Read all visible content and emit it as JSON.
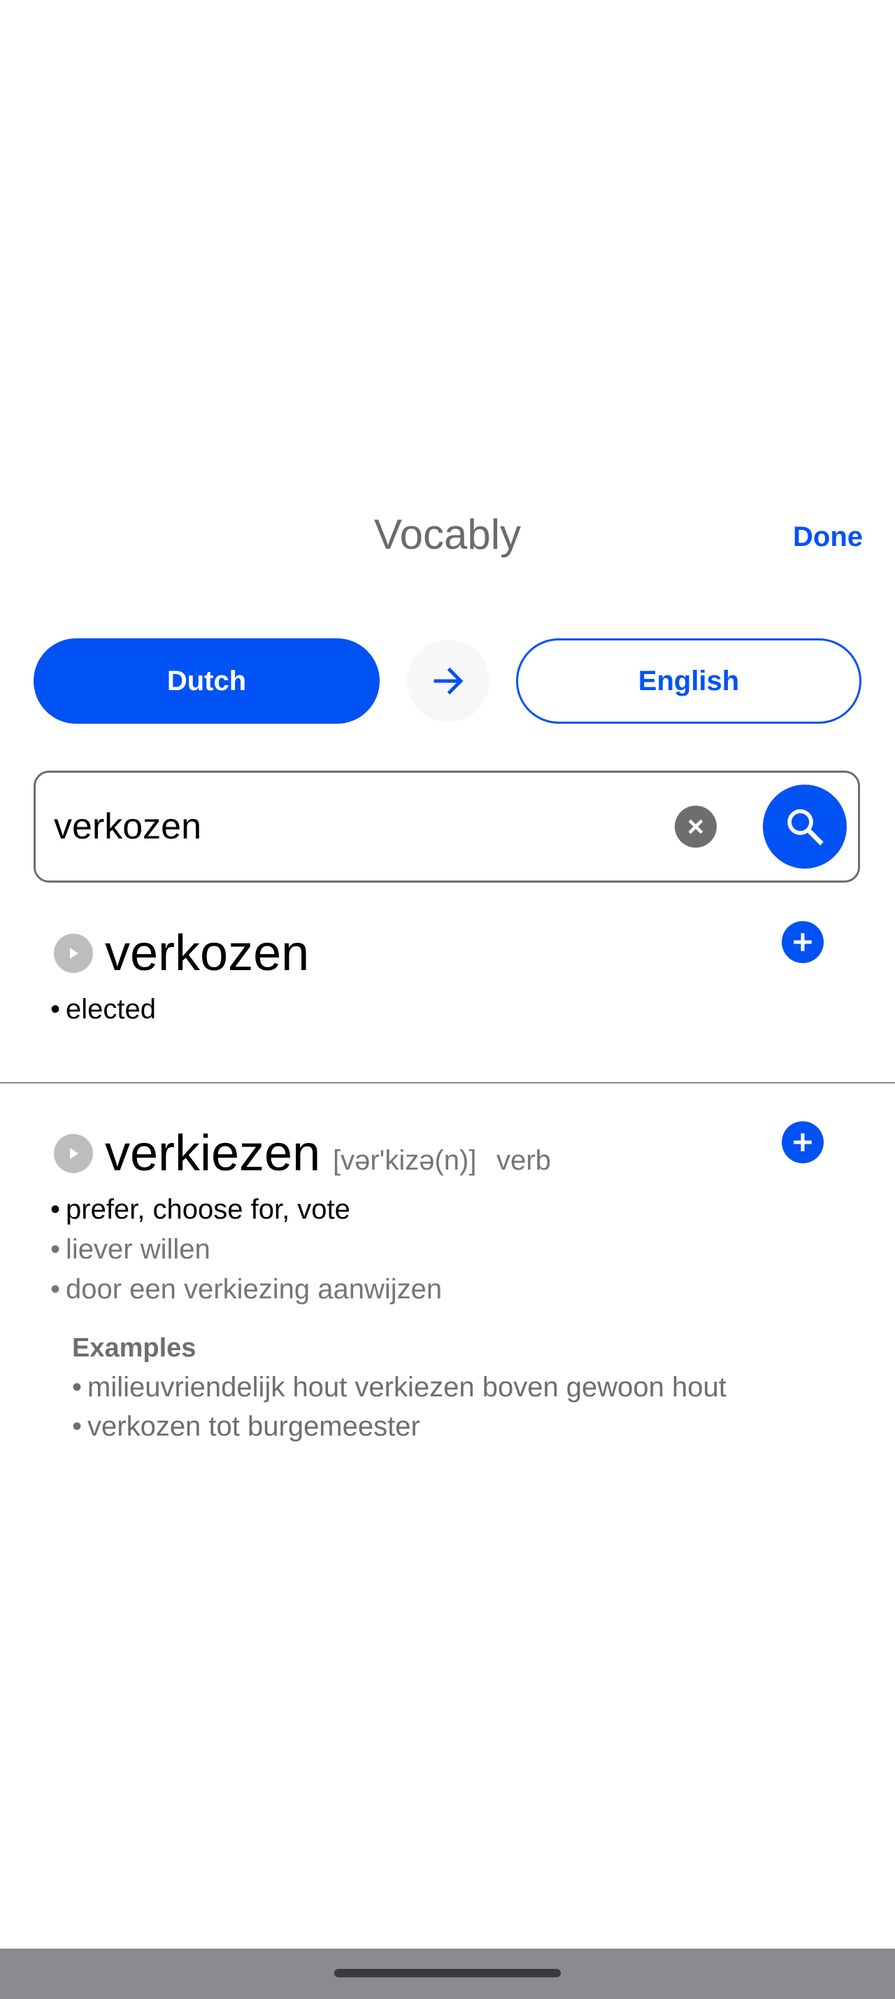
{
  "header": {
    "title": "Vocably",
    "done_label": "Done"
  },
  "languages": {
    "source": "Dutch",
    "target": "English",
    "swap_icon": "arrow-right-icon"
  },
  "search": {
    "value": "verkozen",
    "clear_icon": "clear-circle-icon",
    "search_icon": "search-icon"
  },
  "results": [
    {
      "headword": "verkozen",
      "pronunciation": "",
      "part_of_speech": "",
      "definitions": [
        {
          "text": "elected",
          "primary": true
        }
      ],
      "examples_title": "",
      "examples": []
    },
    {
      "headword": "verkiezen",
      "pronunciation": "[vər'kizə(n)]",
      "part_of_speech": "verb",
      "definitions": [
        {
          "text": "prefer, choose for, vote",
          "primary": true
        },
        {
          "text": "liever willen",
          "primary": false
        },
        {
          "text": "door een verkiezing aanwijzen",
          "primary": false
        }
      ],
      "examples_title": "Examples",
      "examples": [
        "milieuvriendelijk hout verkiezen boven gewoon hout",
        "verkozen tot burgemeester"
      ]
    }
  ],
  "bullet": "•",
  "colors": {
    "accent": "#0052f5",
    "muted_text": "#757575",
    "play_icon_bg": "#bdbdbd",
    "nav_bar": "#8a8b8f"
  }
}
